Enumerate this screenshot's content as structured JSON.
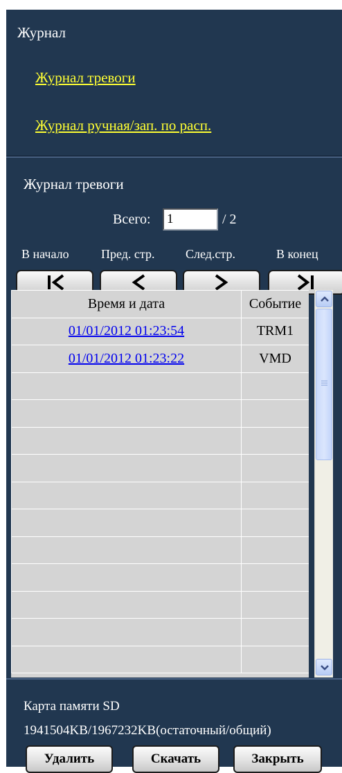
{
  "journal": {
    "title": "Журнал",
    "links": [
      "Журнал тревоги",
      "Журнал ручная/зап. по расп."
    ]
  },
  "alarm_log": {
    "title": "Журнал тревоги",
    "page_label": "Всего:",
    "page_value": "1",
    "page_total": "/ 2",
    "nav_labels": {
      "first": "В начало",
      "prev": "Пред. стр.",
      "next": "След.стр.",
      "last": "В конец"
    },
    "icons": {
      "first": "first-page-icon",
      "prev": "previous-page-icon",
      "next": "next-page-icon",
      "last": "last-page-icon"
    }
  },
  "table": {
    "headers": [
      "Время и дата",
      "Событие"
    ],
    "rows": [
      [
        "01/01/2012 01:23:54",
        "TRM1"
      ],
      [
        "01/01/2012 01:23:22",
        "VMD"
      ],
      [
        "",
        ""
      ],
      [
        "",
        ""
      ],
      [
        "",
        ""
      ],
      [
        "",
        ""
      ],
      [
        "",
        ""
      ],
      [
        "",
        ""
      ],
      [
        "",
        ""
      ],
      [
        "",
        ""
      ],
      [
        "",
        ""
      ],
      [
        "",
        ""
      ],
      [
        "",
        ""
      ]
    ]
  },
  "sd_card": {
    "label": "Карта памяти SD",
    "value": "1941504KB/1967232KB(остаточный/общий)"
  },
  "actions": {
    "delete": "Удалить",
    "download": "Скачать",
    "close": "Закрыть"
  },
  "colors": {
    "panel_bg": "#213750",
    "link_yellow": "#ffff33",
    "table_bg": "#d4d4d4",
    "link_blue": "#0000ee"
  }
}
